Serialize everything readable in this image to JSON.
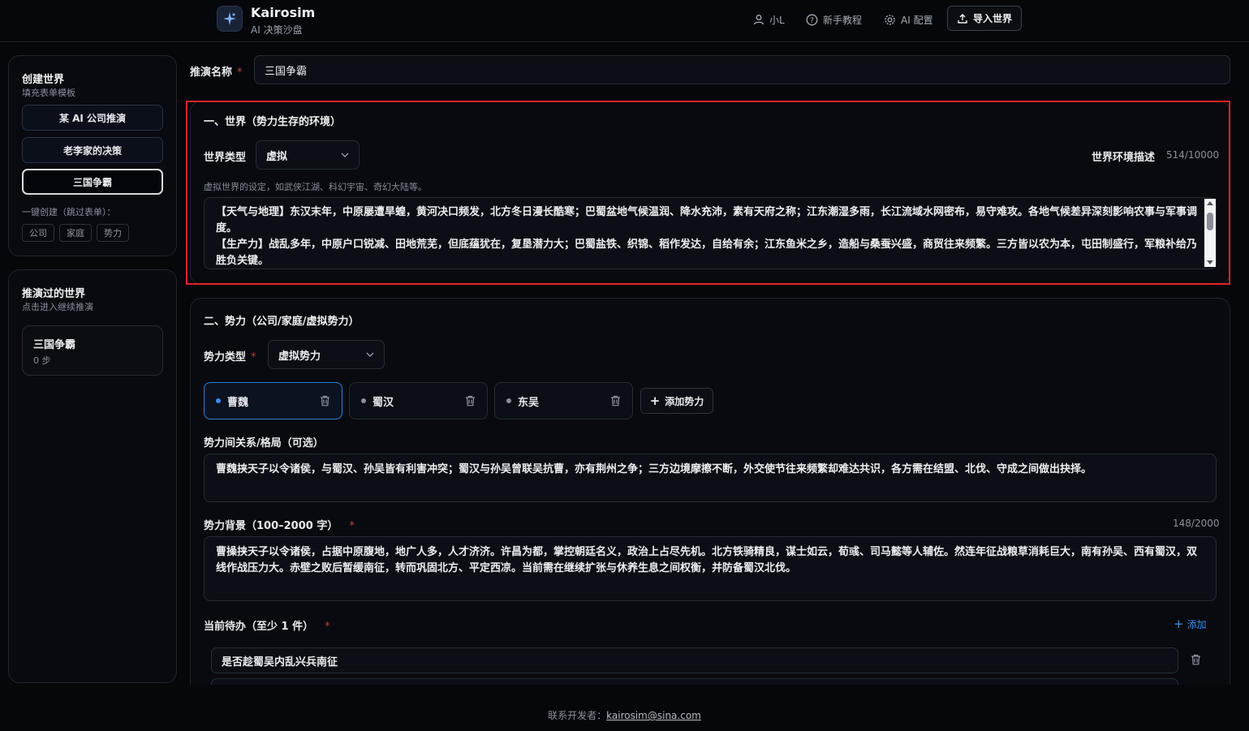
{
  "header": {
    "brand_title": "Kairosim",
    "brand_subtitle": "AI 决策沙盘",
    "nav": {
      "user": "小L",
      "tutorial": "新手教程",
      "ai_config": "AI 配置",
      "import": "导入世界"
    }
  },
  "sidebar": {
    "create": {
      "title": "创建世界",
      "subtitle": "填充表单模板",
      "templates": [
        "某 AI 公司推演",
        "老李家的决策",
        "三国争霸"
      ],
      "quick_label": "一键创建（跳过表单）：",
      "quick_chips": [
        "公司",
        "家庭",
        "势力"
      ]
    },
    "history": {
      "title": "推演过的世界",
      "subtitle": "点击进入继续推演",
      "worlds": [
        {
          "name": "三国争霸",
          "steps": "0 步"
        }
      ]
    }
  },
  "form": {
    "name_label": "推演名称",
    "name_value": "三国争霸",
    "required_mark": "*",
    "world": {
      "title": "一、世界（势力生存的环境）",
      "type_label": "世界类型",
      "type_value": "虚拟",
      "desc_label": "世界环境描述",
      "desc_count": "514/10000",
      "hint": "虚拟世界的设定，如武侠江湖、科幻宇宙、奇幻大陆等。",
      "description": "【天气与地理】东汉末年，中原屡遭旱蝗，黄河决口频发，北方冬日漫长酷寒；巴蜀盆地气候温润、降水充沛，素有天府之称；江东潮湿多雨，长江流域水网密布，易守难攻。各地气候差异深刻影响农事与军事调度。\n【生产力】战乱多年，中原户口锐减、田地荒芜，但底蕴犹在，复垦潜力大；巴蜀盐铁、织锦、稻作发达，自给有余；江东鱼米之乡，造船与桑蚕兴盛，商贸往来频繁。三方皆以农为本，屯田制盛行，军粮补给乃胜负关键。"
    },
    "faction": {
      "title": "二、势力（公司/家庭/虚拟势力）",
      "type_label": "势力类型",
      "type_value": "虚拟势力",
      "list": [
        "曹魏",
        "蜀汉",
        "东吴"
      ],
      "add_label": "添加势力",
      "relations_label": "势力间关系/格局（可选）",
      "relations_value": "曹魏挟天子以令诸侯，与蜀汉、孙吴皆有利害冲突；蜀汉与孙吴曾联吴抗曹，亦有荆州之争；三方边境摩擦不断，外交使节往来频繁却难达共识，各方需在结盟、北伐、守成之间做出抉择。",
      "background_label": "势力背景（100–2000 字）",
      "background_count": "148/2000",
      "background_value": "曹操挟天子以令诸侯，占据中原腹地，地广人多，人才济济。许昌为都，掌控朝廷名义，政治上占尽先机。北方铁骑精良，谋士如云，荀彧、司马懿等人辅佐。然连年征战粮草消耗巨大，南有孙吴、西有蜀汉，双线作战压力大。赤壁之败后暂缓南征，转而巩固北方、平定西凉。当前需在继续扩张与休养生息之间权衡，并防备蜀汉北伐。",
      "todo_label": "当前待办（至少 1 件）",
      "todo_add": "添加",
      "todos": [
        "是否趁蜀吴内乱兴兵南征"
      ]
    }
  },
  "footer": {
    "prefix": "联系开发者：",
    "email": "kairosim@sina.com"
  },
  "colors": {
    "accent": "#2f7fd6",
    "required": "#c2413a",
    "highlight": "#e0242a"
  }
}
